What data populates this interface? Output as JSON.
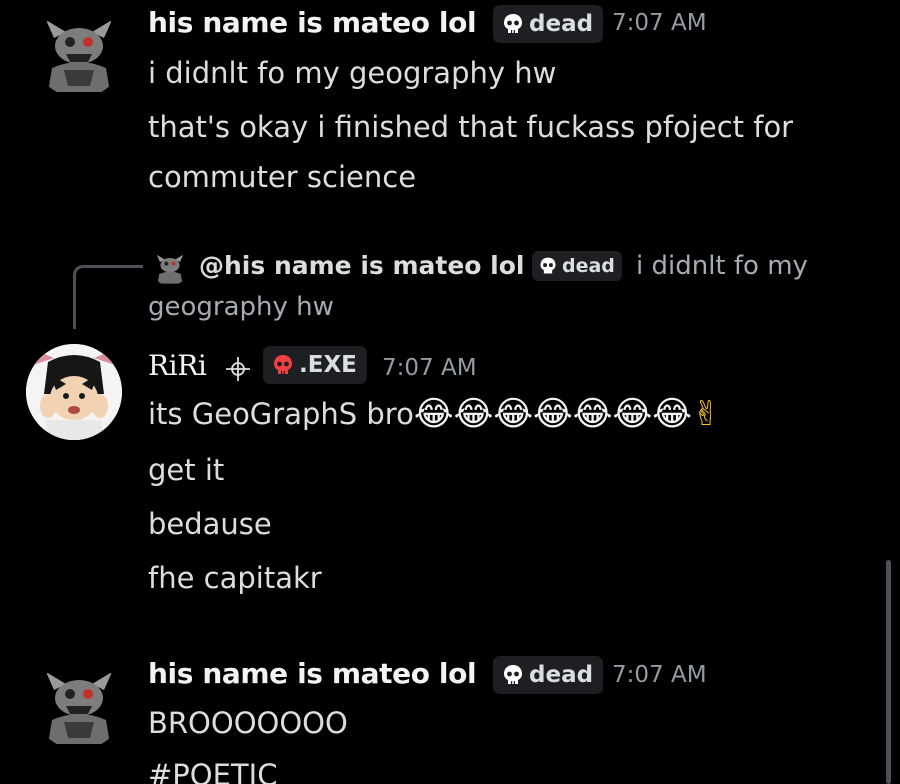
{
  "messages": [
    {
      "author": "his name is mateo lol",
      "tag": "dead",
      "time": "7:07 AM",
      "lines": [
        "i didnlt fo my geography hw",
        "that's okay i finished that fuckass pfoject for",
        "commuter science"
      ]
    },
    {
      "reply": {
        "author": "@his name is mateo lol",
        "tag": "dead",
        "text_first": "i didnlt fo my",
        "text_second": "geography hw"
      },
      "author": "RiRi",
      "tag": ".EXE",
      "time": "7:07 AM",
      "lines": [
        "its GeoGraphS bro",
        "get it",
        "bedause",
        "fhe capitakr"
      ],
      "emoji": [
        "😂",
        "😂",
        "😂",
        "😂",
        "😂",
        "😂",
        "😂",
        "✌"
      ]
    },
    {
      "author": "his name is mateo lol",
      "tag": "dead",
      "time": "7:07 AM",
      "lines": [
        "BROOOOOOO",
        "#POETIC"
      ]
    }
  ],
  "colors": {
    "background": "#000000",
    "name": "#f2f3f5",
    "text": "#dbdee1",
    "muted": "#949ba4",
    "tag_bg": "#1e1f22",
    "skull": "#ffffff",
    "exe_skull": "#f23f42"
  },
  "icons": {
    "tag_dead": "skull-icon",
    "tag_exe": "skull-icon",
    "crosshair": "crosshair-icon"
  }
}
